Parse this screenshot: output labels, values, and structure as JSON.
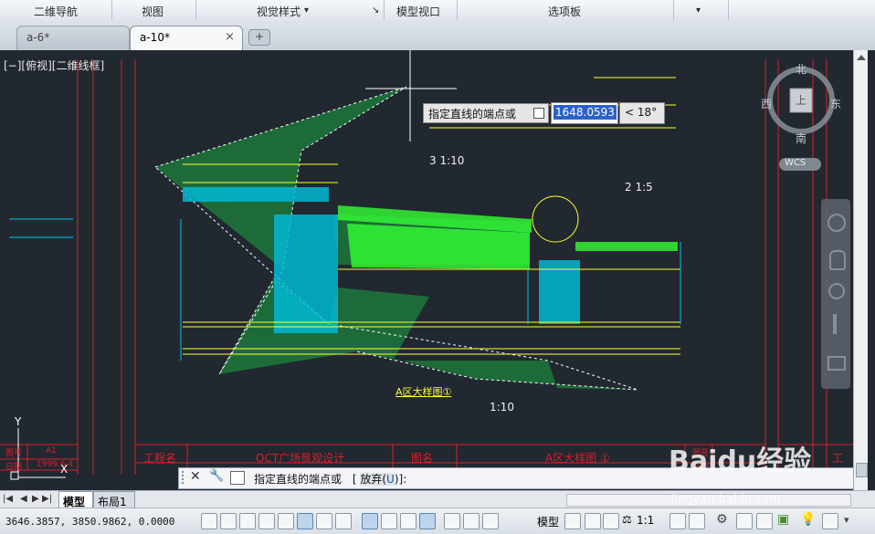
{
  "ribbon": {
    "panels": [
      "二维导航",
      "视图",
      "视觉样式",
      "模型视口",
      "选项板"
    ],
    "visual_style_dropdown": "▾",
    "expand_arrow": "↘",
    "more_arrow": "▾"
  },
  "tabs": {
    "items": [
      {
        "label": "a-6*",
        "active": false
      },
      {
        "label": "a-10*",
        "active": true
      }
    ],
    "close_glyph": "×",
    "new_tab_glyph": "+"
  },
  "viewport": {
    "view_label": "[−][俯视][二维线框]",
    "viewcube": {
      "north": "北",
      "south": "南",
      "east": "东",
      "west": "西",
      "top": "上",
      "wcs": "WCS"
    },
    "tooltip": {
      "prompt": "指定直线的端点或",
      "length_value": "1648.0593",
      "angle_value": "< 18°"
    },
    "drawing": {
      "scale_label_1": "3 1:10",
      "scale_label_2": "2 1:5",
      "scale_label_3": "1:10",
      "detail_title": "A区大样图①",
      "title_block": {
        "project_label": "工程名",
        "project_name": "OCT广场景观设计",
        "drawing_label": "图名",
        "drawing_name": "A区大样图 ①",
        "left_block": [
          "图号",
          "A1",
          "日期",
          "1999.6.4"
        ],
        "right_block": [
          "图号",
          "日期"
        ],
        "far_right": "工程"
      }
    },
    "ucs": {
      "y_label": "Y",
      "x_label": "X"
    }
  },
  "command_line": {
    "prompt": "指定直线的端点或",
    "option_bracket_open": "[",
    "option_text": "放弃(",
    "option_key": "U",
    "option_tail": ")]:"
  },
  "layout_tabs": {
    "model": "模型",
    "layout1": "布局1"
  },
  "status": {
    "coordinates": "3646.3857, 3850.9862, 0.0000",
    "model_label": "模型",
    "scale": "1:1"
  },
  "watermark": {
    "text": "Baidu经验",
    "url": "jingyan.baidu.com"
  },
  "colors": {
    "canvas": "#212830",
    "frame_red": "#d8202b",
    "hatch_green": "#1e6b3a",
    "grass_green": "#33ff33",
    "cyan": "#00c8e6",
    "yellow": "#ffff33"
  }
}
